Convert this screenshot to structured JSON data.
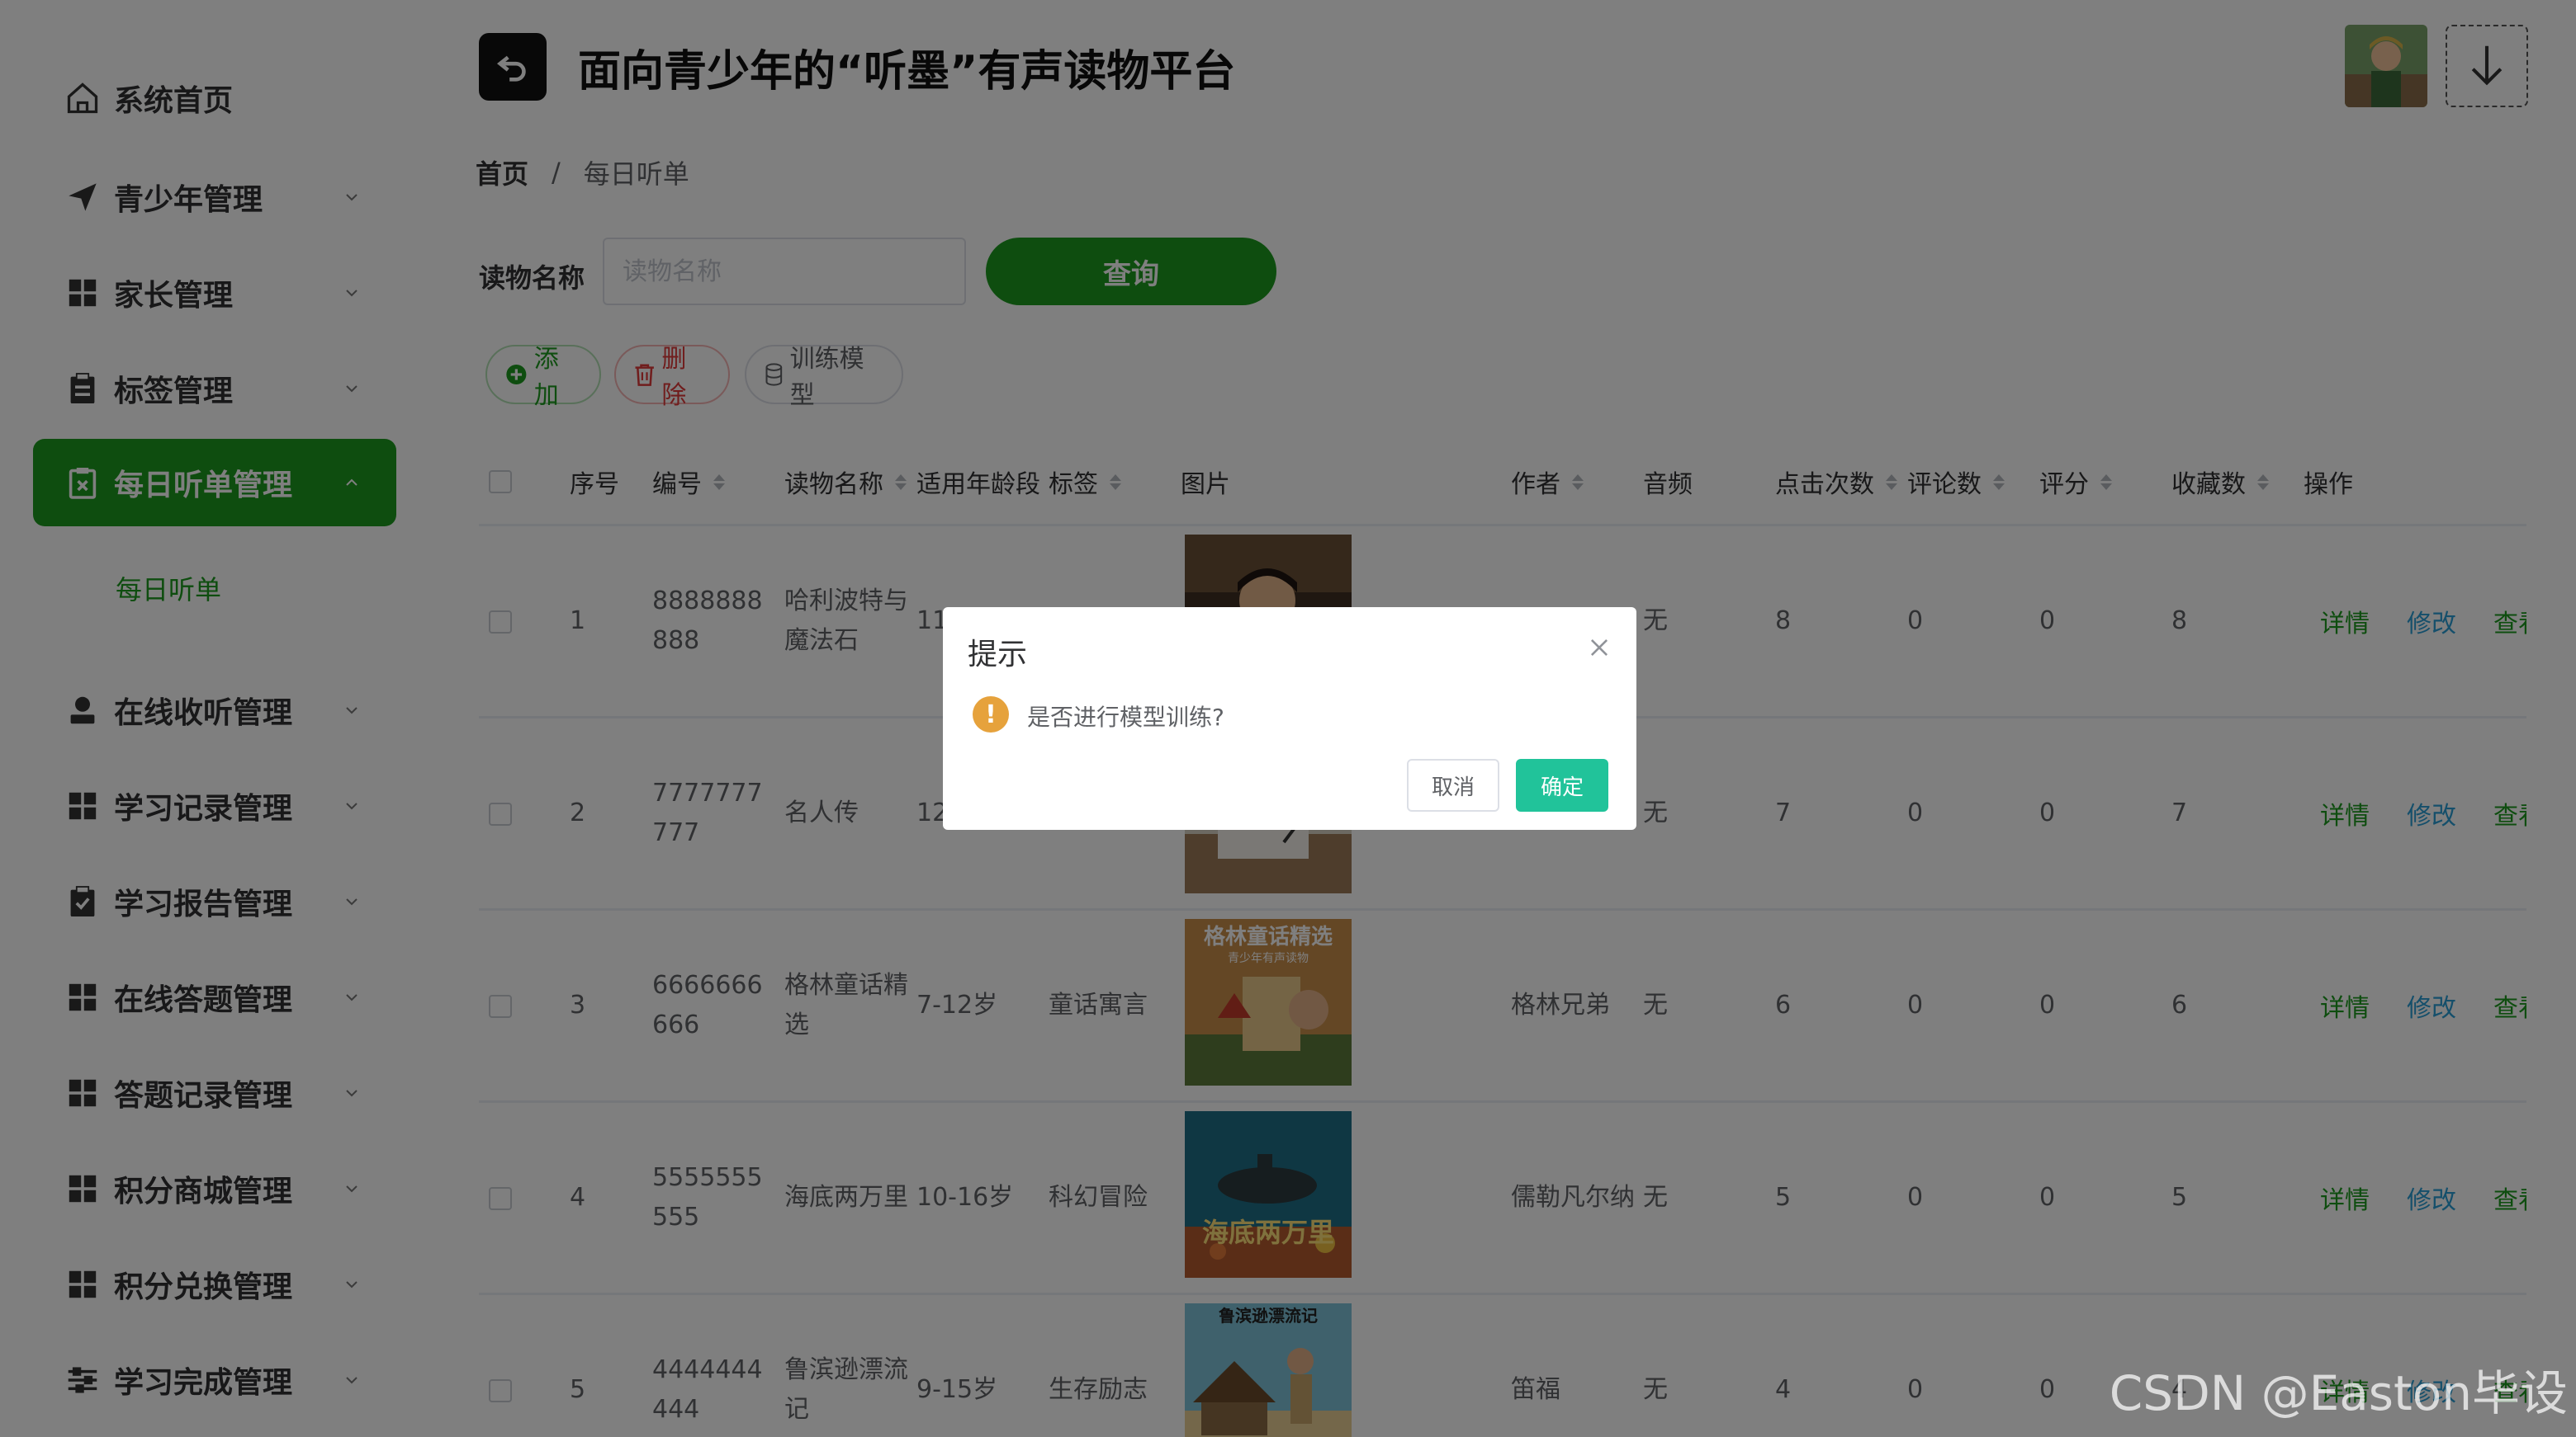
{
  "app": {
    "title": "面向青少年的“听墨”有声读物平台"
  },
  "sidebar": {
    "items": [
      {
        "label": "系统首页",
        "icon": "home-icon"
      },
      {
        "label": "青少年管理",
        "icon": "send-icon"
      },
      {
        "label": "家长管理",
        "icon": "grid-icon"
      },
      {
        "label": "标签管理",
        "icon": "clipboard-icon"
      },
      {
        "label": "每日听单管理",
        "icon": "delete-doc-icon"
      },
      {
        "label": "在线收听管理",
        "icon": "user-icon"
      },
      {
        "label": "学习记录管理",
        "icon": "grid-icon"
      },
      {
        "label": "学习报告管理",
        "icon": "clipboard-check-icon"
      },
      {
        "label": "在线答题管理",
        "icon": "grid-icon"
      },
      {
        "label": "答题记录管理",
        "icon": "grid-icon"
      },
      {
        "label": "积分商城管理",
        "icon": "grid-icon"
      },
      {
        "label": "积分兑换管理",
        "icon": "grid-icon"
      },
      {
        "label": "学习完成管理",
        "icon": "sliders-icon"
      }
    ],
    "active_sub": "每日听单"
  },
  "breadcrumb": {
    "home": "首页",
    "sep": "/",
    "current": "每日听单"
  },
  "search": {
    "label": "读物名称",
    "placeholder": "读物名称",
    "value": "",
    "button": "查询"
  },
  "actions": {
    "add": "添加",
    "delete": "删除",
    "train": "训练模型"
  },
  "table": {
    "headers": {
      "index": "序号",
      "code": "编号",
      "name": "读物名称",
      "age": "适用年龄段",
      "tag": "标签",
      "image": "图片",
      "author": "作者",
      "audio": "音频",
      "clicks": "点击次数",
      "comments": "评论数",
      "rating": "评分",
      "favorites": "收藏数",
      "ops": "操作"
    },
    "ops": {
      "detail": "详情",
      "edit": "修改",
      "view": "查看"
    },
    "rows": [
      {
        "index": "1",
        "code": "8888888888",
        "name": "哈利波特与魔法石",
        "age": "11",
        "tag": "",
        "author": "",
        "audio": "无",
        "clicks": "8",
        "comments": "0",
        "rating": "0",
        "favorites": "8"
      },
      {
        "index": "2",
        "code": "7777777777",
        "name": "名人传",
        "age": "12",
        "tag": "",
        "author": "",
        "audio": "无",
        "clicks": "7",
        "comments": "0",
        "rating": "0",
        "favorites": "7"
      },
      {
        "index": "3",
        "code": "6666666666",
        "name": "格林童话精选",
        "age": "7-12岁",
        "tag": "童话寓言",
        "author": "格林兄弟",
        "audio": "无",
        "clicks": "6",
        "comments": "0",
        "rating": "0",
        "favorites": "6"
      },
      {
        "index": "4",
        "code": "5555555555",
        "name": "海底两万里",
        "age": "10-16岁",
        "tag": "科幻冒险",
        "author": "儒勒凡尔纳",
        "audio": "无",
        "clicks": "5",
        "comments": "0",
        "rating": "0",
        "favorites": "5"
      },
      {
        "index": "5",
        "code": "4444444444",
        "name": "鲁滨逊漂流记",
        "age": "9-15岁",
        "tag": "生存励志",
        "author": "笛福",
        "audio": "无",
        "clicks": "4",
        "comments": "0",
        "rating": "0",
        "favorites": "4"
      }
    ],
    "cover_texts": {
      "row3_title": "格林童话精选",
      "row3_sub": "青少年有声读物",
      "row4_title": "海底两万里",
      "row5_title": "鲁滨逊漂流记"
    }
  },
  "dialog": {
    "title": "提示",
    "message": "是否进行模型训练?",
    "cancel": "取消",
    "confirm": "确定"
  },
  "watermark": "CSDN @Easton毕设",
  "colors": {
    "primary": "#1c9a1f",
    "link": "#2a9fd6",
    "danger": "#e03a3a",
    "confirm": "#21c39a",
    "warning": "#e6a23c"
  }
}
